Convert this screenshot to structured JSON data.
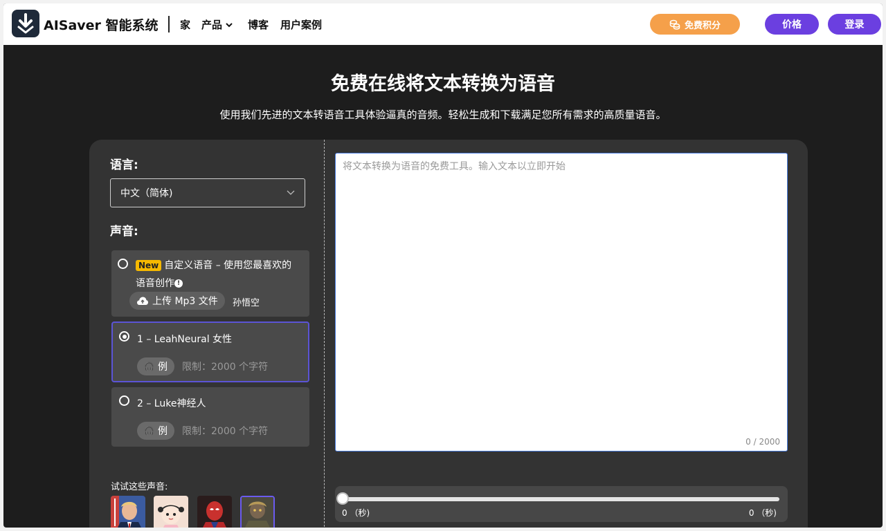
{
  "header": {
    "brand": "AISaver 智能系统",
    "nav": {
      "home": "家",
      "products": "产品",
      "blog": "博客",
      "cases": "用户案例"
    },
    "free_credits": "免费积分",
    "pricing": "价格",
    "login": "登录"
  },
  "hero": {
    "title": "免费在线将文本转换为语音",
    "subtitle": "使用我们先进的文本转语音工具体验逼真的音频。轻松生成和下载满足您所有需求的高质量语音。"
  },
  "panel": {
    "language_label": "语言:",
    "language_value": "中文（简体)",
    "voice_label": "声音:",
    "voices": [
      {
        "badge": "New",
        "text_line1": "自定义语音 – 使用您最喜欢的",
        "text_line2": "语音创作",
        "upload_label": "上传 Mp3 文件",
        "side_name": "孙悟空",
        "selected": false
      },
      {
        "name": "1 – LeahNeural 女性",
        "sample_label": "例",
        "limit": "限制：2000 个字符",
        "selected": true
      },
      {
        "name": "2 – Luke神经人",
        "sample_label": "例",
        "limit": "限制：2000 个字符",
        "selected": false
      }
    ],
    "try_label": "试试这些声音:"
  },
  "editor": {
    "placeholder": "将文本转换为语音的免费工具。输入文本以立即开始",
    "value": "",
    "counter": "0 / 2000"
  },
  "audio": {
    "current_time": "0 （秒)",
    "total_time": "0 （秒)",
    "progress": 0
  },
  "colors": {
    "accent_purple": "#6b3fe0",
    "accent_orange": "#f5a04a",
    "badge_yellow": "#f5b800",
    "selected_border": "#5b54d6"
  }
}
